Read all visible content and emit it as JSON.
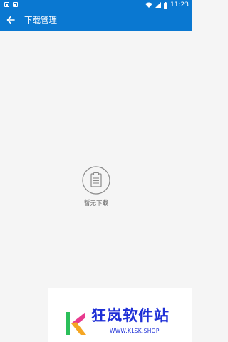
{
  "status_bar": {
    "time": "11:23"
  },
  "app_bar": {
    "title": "下载管理",
    "back_icon": "arrow-left-icon"
  },
  "empty_state": {
    "icon": "clipboard-icon",
    "message": "暂无下载"
  },
  "watermark": {
    "brand": "狂岚软件站",
    "url": "WWW.KLSK.SHOP"
  },
  "colors": {
    "primary": "#0a78d1",
    "background": "#f5f5f5",
    "empty_text": "#666666",
    "watermark_blue": "#1e2fd6"
  }
}
